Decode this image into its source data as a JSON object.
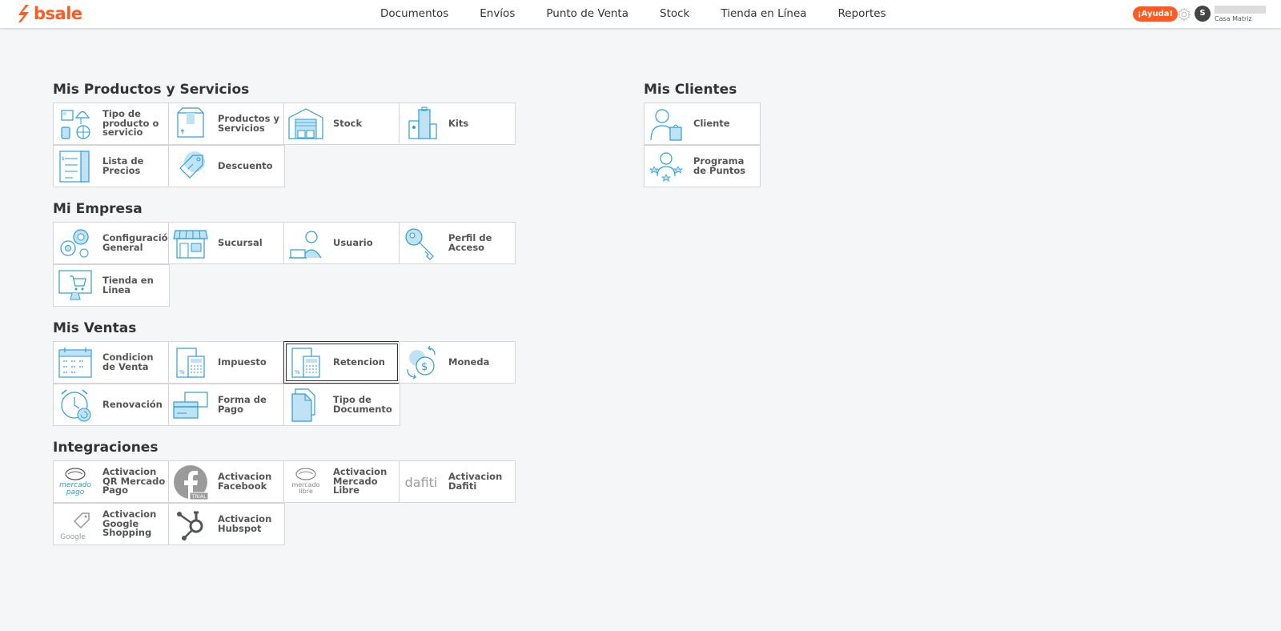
{
  "brand": {
    "name": "bsale",
    "color": "#ff5a1f"
  },
  "nav": {
    "items": [
      "Documentos",
      "Envíos",
      "Punto de Venta",
      "Stock",
      "Tienda en Línea",
      "Reportes"
    ]
  },
  "header": {
    "help_label": "¡Ayuda!",
    "avatar_initial": "S",
    "branch": "Casa Matriz"
  },
  "colors": {
    "accent": "#ff5a1f",
    "icon_blue": "#2a9fd6",
    "icon_fill": "#bfe3f5",
    "gray": "#888888"
  },
  "sections": {
    "productos": {
      "title": "Mis Productos y Servicios",
      "tiles": [
        {
          "label": "Tipo de producto o servicio",
          "icon": "product-types-icon"
        },
        {
          "label": "Productos y Servicios",
          "icon": "box-icon"
        },
        {
          "label": "Stock",
          "icon": "warehouse-icon"
        },
        {
          "label": "Kits",
          "icon": "kits-icon"
        },
        {
          "label": "Lista de Precios",
          "icon": "price-list-icon"
        },
        {
          "label": "Descuento",
          "icon": "discount-tag-icon"
        }
      ]
    },
    "empresa": {
      "title": "Mi Empresa",
      "tiles": [
        {
          "label": "Configuración General",
          "icon": "gears-icon"
        },
        {
          "label": "Sucursal",
          "icon": "store-icon"
        },
        {
          "label": "Usuario",
          "icon": "user-laptop-icon"
        },
        {
          "label": "Perfil de Acceso",
          "icon": "key-icon"
        },
        {
          "label": "Tienda en Linea",
          "icon": "online-store-icon"
        }
      ]
    },
    "ventas": {
      "title": "Mis Ventas",
      "tiles": [
        {
          "label": "Condicion de Venta",
          "icon": "calendar-icon"
        },
        {
          "label": "Impuesto",
          "icon": "tax-calculator-icon"
        },
        {
          "label": "Retencion",
          "icon": "retention-calculator-icon"
        },
        {
          "label": "Moneda",
          "icon": "currency-exchange-icon"
        },
        {
          "label": "Renovación",
          "icon": "alarm-clock-icon"
        },
        {
          "label": "Forma de Pago",
          "icon": "credit-cards-icon"
        },
        {
          "label": "Tipo de Documento",
          "icon": "document-icon"
        }
      ]
    },
    "integraciones": {
      "title": "Integraciones",
      "tiles": [
        {
          "label": "Activacion QR Mercado Pago",
          "icon": "mercado-pago-logo-icon",
          "logo_lines": [
            "mercado",
            "pago"
          ]
        },
        {
          "label": "Activacion Facebook",
          "icon": "facebook-trial-icon",
          "badge": "TRIAL"
        },
        {
          "label": "Activacion Mercado Libre",
          "icon": "mercado-libre-logo-icon",
          "logo_lines": [
            "mercado",
            "libre"
          ]
        },
        {
          "label": "Activacion Dafiti",
          "icon": "dafiti-logo-icon",
          "logo_text": "dafiti"
        },
        {
          "label": "Activacion Google Shopping",
          "icon": "google-shopping-icon",
          "logo_text": "Google"
        },
        {
          "label": "Activacion Hubspot",
          "icon": "hubspot-icon"
        }
      ]
    },
    "clientes": {
      "title": "Mis Clientes",
      "tiles": [
        {
          "label": "Cliente",
          "icon": "client-shopping-icon"
        },
        {
          "label": "Programa de Puntos",
          "icon": "loyalty-points-icon"
        }
      ]
    }
  }
}
